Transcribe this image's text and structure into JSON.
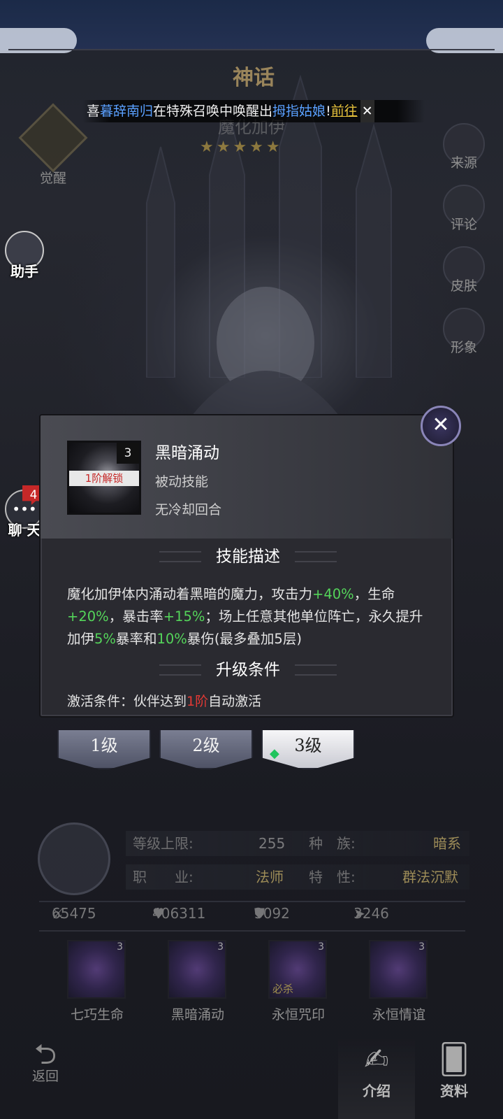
{
  "banner": {
    "prefix": "喜",
    "player": "暮辞南归",
    "middle": "在特殊召唤中唤醒出",
    "hero": "拇指姑娘",
    "bang": "!",
    "goto": "前往"
  },
  "title": {
    "rank": "神话",
    "hero_name": "魔化加伊",
    "stars": "★★★★★"
  },
  "left": {
    "awaken": "觉醒",
    "helper": "助手",
    "chat": "聊 天",
    "chat_badge": "4"
  },
  "right": {
    "items": [
      {
        "label": "来源",
        "icon": "globe-icon"
      },
      {
        "label": "评论",
        "icon": "comment-icon"
      },
      {
        "label": "皮肤",
        "icon": "skin-icon"
      },
      {
        "label": "形象",
        "icon": "hat-icon"
      }
    ]
  },
  "popup": {
    "skill_level": "3",
    "unlock": "1阶解锁",
    "skill_name": "黑暗涌动",
    "skill_type": "被动技能",
    "cooldown": "无冷却回合",
    "desc_title": "技能描述",
    "desc": {
      "p1": "魔化加伊体内涌动着黑暗的魔力，攻击力",
      "atk": "+40%",
      "p2": "，生命",
      "hp": "+20%",
      "p3": "，暴击率",
      "crit": "+15%",
      "p4": "；场上任意其他单位阵亡，永久提升加伊",
      "crit2": "5%",
      "p5": "暴率和",
      "critdmg": "10%",
      "p6": "暴伤(最多叠加5层)"
    },
    "upgrade_title": "升级条件",
    "cond_prefix": "激活条件：伙伴达到",
    "cond_rank": "1阶",
    "cond_suffix": "自动激活"
  },
  "tabs": [
    {
      "label": "1级"
    },
    {
      "label": "2级"
    },
    {
      "label": "3级"
    }
  ],
  "stats": {
    "level_cap_label": "等级上限:",
    "level_cap": "255",
    "race_label": "种　族:",
    "race": "暗系",
    "class_label": "职　　业:",
    "class": "法师",
    "trait_label": "特　性:",
    "trait": "群法沉默",
    "attack": "65475",
    "hp": "406311",
    "defense": "3092",
    "speed": "3246"
  },
  "skills": [
    {
      "label": "七巧生命",
      "level": "3",
      "tag": ""
    },
    {
      "label": "黑暗涌动",
      "level": "3",
      "tag": ""
    },
    {
      "label": "永恒咒印",
      "level": "3",
      "tag": "必杀"
    },
    {
      "label": "永恒情谊",
      "level": "3",
      "tag": ""
    }
  ],
  "nav": {
    "back": "返回",
    "intro": "介绍",
    "info": "资料"
  },
  "colors": {
    "green": "#54d45a",
    "red": "#e53935",
    "blue": "#5aa0ff",
    "gold": "#e7c23c"
  }
}
